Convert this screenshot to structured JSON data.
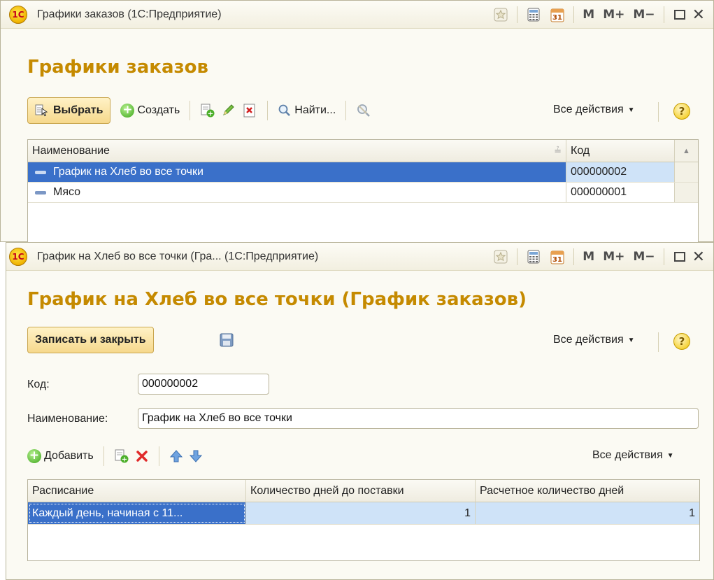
{
  "list_window": {
    "title": "Графики заказов  (1С:Предприятие)",
    "heading": "Графики заказов",
    "toolbar": {
      "select_label": "Выбрать",
      "create_label": "Создать",
      "find_label": "Найти...",
      "all_actions_label": "Все действия"
    },
    "table": {
      "columns": [
        "Наименование",
        "Код"
      ],
      "rows": [
        {
          "name": "График на Хлеб во все точки",
          "code": "000000002"
        },
        {
          "name": "Мясо",
          "code": "000000001"
        }
      ]
    }
  },
  "titlebar_tools": {
    "m_label": "M",
    "m_plus_label": "M+",
    "m_minus_label": "M−",
    "close_label": "✕",
    "calendar_label": "31"
  },
  "form_window": {
    "title": "График на Хлеб во все точки (Гра...  (1С:Предприятие)",
    "heading": "График на Хлеб во все точки (График заказов)",
    "toolbar": {
      "save_close_label": "Записать и закрыть",
      "all_actions_label": "Все действия"
    },
    "fields": {
      "code_label": "Код:",
      "code_value": "000000002",
      "name_label": "Наименование:",
      "name_value": "График на Хлеб во все точки"
    },
    "table_toolbar": {
      "add_label": "Добавить",
      "all_actions_label": "Все действия"
    },
    "table": {
      "columns": [
        "Расписание",
        "Количество дней до поставки",
        "Расчетное количество дней"
      ],
      "rows": [
        {
          "schedule": "Каждый день, начиная с 11...",
          "days_to_delivery": "1",
          "calculated_days": "1"
        }
      ]
    }
  },
  "colors": {
    "heading": "#c58a00",
    "selection": "#3a70c9",
    "row_highlight": "#cfe3f8",
    "window_bg": "#fbfaf3"
  }
}
